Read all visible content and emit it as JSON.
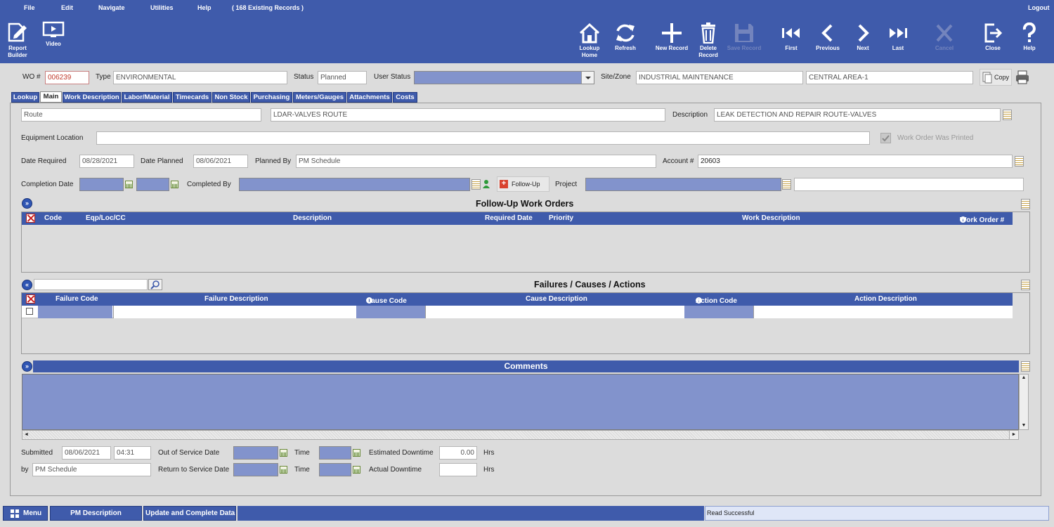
{
  "menu": {
    "file": "File",
    "edit": "Edit",
    "navigate": "Navigate",
    "utilities": "Utilities",
    "help": "Help",
    "records": "( 168 Existing Records )",
    "logout": "Logout"
  },
  "toolbar": {
    "report_builder": "Report Builder",
    "video": "Video",
    "lookup_home": "Lookup Home",
    "refresh": "Refresh",
    "new_record": "New Record",
    "delete_record": "Delete Record",
    "save_record": "Save Record",
    "first": "First",
    "previous": "Previous",
    "next": "Next",
    "last": "Last",
    "cancel": "Cancel",
    "close": "Close",
    "help": "Help"
  },
  "top": {
    "wo_label": "WO #",
    "wo_value": "006239",
    "type_label": "Type",
    "type_value": "ENVIRONMENTAL",
    "status_label": "Status",
    "status_value": "Planned",
    "user_status_label": "User Status",
    "user_status_value": "",
    "site_label": "Site/Zone",
    "site_value": "INDUSTRIAL  MAINTENANCE",
    "zone_value": "CENTRAL AREA-1",
    "copy": "Copy"
  },
  "tabs": [
    "Lookup",
    "Main",
    "Work Description",
    "Labor/Material",
    "Timecards",
    "Non Stock",
    "Purchasing",
    "Meters/Gauges",
    "Attachments",
    "Costs"
  ],
  "main": {
    "route_label": "Route",
    "route_value": "LDAR-VALVES ROUTE",
    "description_label": "Description",
    "description_value": "LEAK DETECTION AND REPAIR ROUTE-VALVES",
    "equipment_location_label": "Equipment Location",
    "equipment_location_value": "",
    "printed_label": "Work Order Was Printed",
    "date_required_label": "Date Required",
    "date_required_value": "08/28/2021",
    "date_planned_label": "Date Planned",
    "date_planned_value": "08/06/2021",
    "planned_by_label": "Planned By",
    "planned_by_value": "PM Schedule",
    "account_label": "Account #",
    "account_value": "20603",
    "completion_date_label": "Completion Date",
    "completed_by_label": "Completed By",
    "follow_up_button": "Follow-Up",
    "project_label": "Project"
  },
  "followup": {
    "title": "Follow-Up Work Orders",
    "columns": [
      "Code",
      "Eqp/Loc/CC",
      "Description",
      "Required Date",
      "Priority",
      "Work Description",
      "Work Order #"
    ]
  },
  "failures": {
    "title": "Failures / Causes / Actions",
    "search_value": "",
    "columns": [
      "Failure Code",
      "Failure Description",
      "Cause Code",
      "Cause Description",
      "Action Code",
      "Action Description"
    ]
  },
  "comments": {
    "title": "Comments"
  },
  "bottom": {
    "submitted_label": "Submitted",
    "submitted_date": "08/06/2021",
    "submitted_time": "04:31",
    "by_label": "by",
    "by_value": "PM Schedule",
    "out_of_service_label": "Out of Service Date",
    "return_to_service_label": "Return to Service Date",
    "time_label": "Time",
    "est_downtime_label": "Estimated Downtime",
    "est_downtime_value": "0.00",
    "actual_downtime_label": "Actual Downtime",
    "actual_downtime_value": "",
    "hrs_label": "Hrs"
  },
  "statusbar": {
    "menu": "Menu",
    "pm_description": "PM Description",
    "update_complete": "Update and Complete Data...",
    "message": "Read Successful"
  },
  "colors": {
    "header": "#3f5bab",
    "field_blue": "#8293cc",
    "panel_bg": "#dcdcdc"
  }
}
